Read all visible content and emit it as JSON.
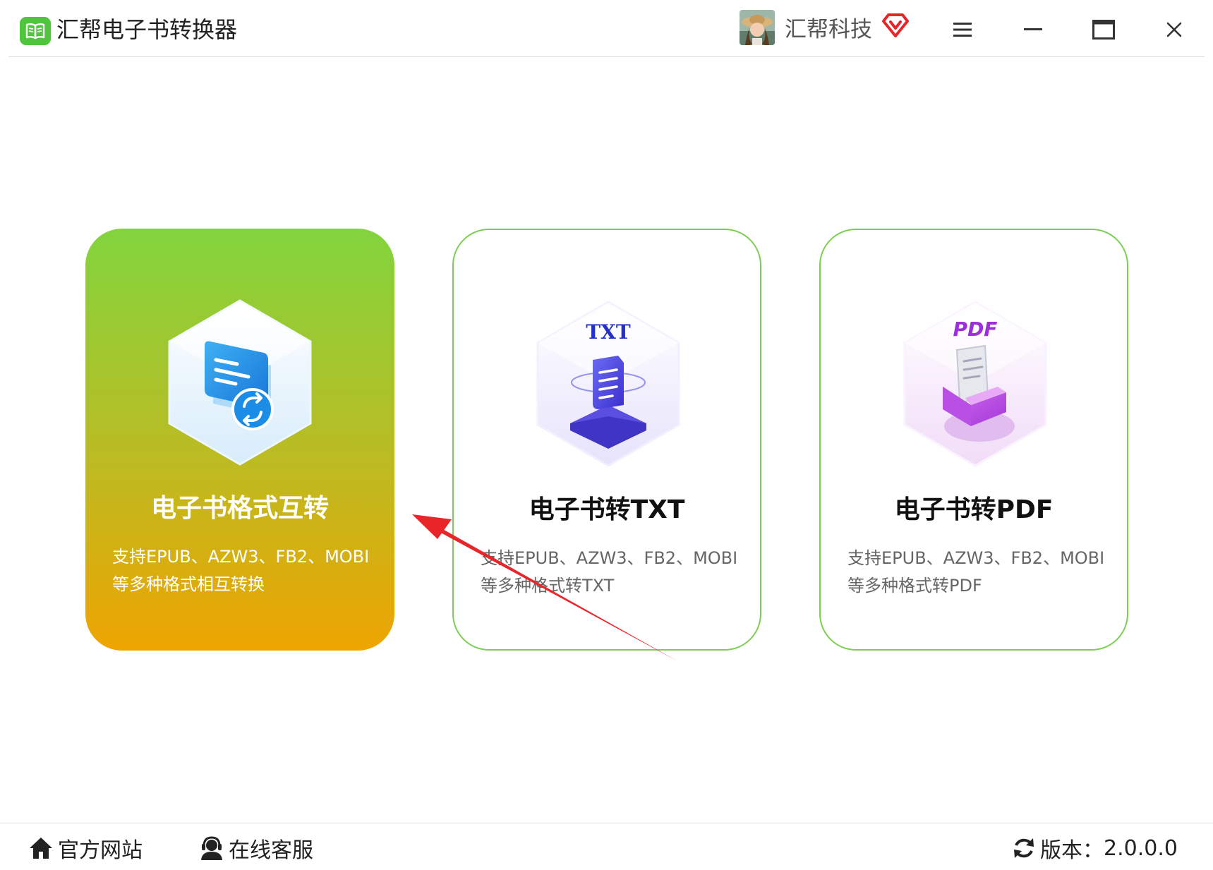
{
  "window": {
    "title": "汇帮电子书转换器",
    "icons": {
      "app": "book-logo-icon",
      "vip": "diamond-vip-icon",
      "menu": "hamburger-menu-icon",
      "minimize": "minimize-icon",
      "maximize": "maximize-icon",
      "close": "close-icon"
    }
  },
  "user": {
    "name": "汇帮科技",
    "avatar": "user-avatar"
  },
  "cards": [
    {
      "id": "format-convert",
      "title": "电子书格式互转",
      "desc_line1": "支持EPUB、AZW3、FB2、MOBI",
      "desc_line2": "等多种格式相互转换",
      "icon": "convert-document-icon",
      "selected": true
    },
    {
      "id": "to-txt",
      "title": "电子书转TXT",
      "desc_line1": "支持EPUB、AZW3、FB2、MOBI",
      "desc_line2": "等多种格式转TXT",
      "icon_label": "TXT",
      "icon": "txt-document-icon",
      "selected": false
    },
    {
      "id": "to-pdf",
      "title": "电子书转PDF",
      "desc_line1": "支持EPUB、AZW3、FB2、MOBI",
      "desc_line2": "等多种格式转PDF",
      "icon_label": "PDF",
      "icon": "pdf-document-icon",
      "selected": false
    }
  ],
  "footer": {
    "website_label": "官方网站",
    "support_label": "在线客服",
    "version_label": "版本：",
    "version_value": "2.0.0.0"
  },
  "colors": {
    "accent_green": "#4fc43d",
    "card_border": "#7ccf54",
    "active_gradient_top": "#82d43d",
    "active_gradient_bottom": "#eea400",
    "annotation_red": "#e8262a",
    "vip_red": "#e8262a"
  }
}
